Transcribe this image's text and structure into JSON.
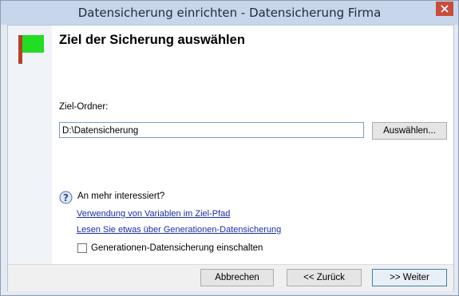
{
  "window": {
    "title": "Datensicherung einrichten - Datensicherung Firma"
  },
  "page": {
    "heading": "Ziel der Sicherung auswählen"
  },
  "target": {
    "label": "Ziel-Ordner:",
    "path_value": "D:\\Datensicherung",
    "browse_label": "Auswählen..."
  },
  "help": {
    "title": "An mehr interessiert?",
    "links": [
      "Verwendung von Variablen im Ziel-Pfad",
      "Lesen Sie etwas über Generationen-Datensicherung"
    ]
  },
  "options": {
    "generations_label": "Generationen-Datensicherung einschalten",
    "generations_checked": false
  },
  "footer": {
    "cancel_label": "Abbrechen",
    "back_label": "<< Zurück",
    "next_label": ">> Weiter"
  },
  "colors": {
    "flag_green": "#22dd22",
    "flag_pole": "#b5402a",
    "link": "#1a2fa3",
    "titlebar": "#c7d6ea",
    "close_button": "#c94c3c"
  },
  "icons": [
    "flag-icon",
    "help-icon",
    "close-icon"
  ]
}
